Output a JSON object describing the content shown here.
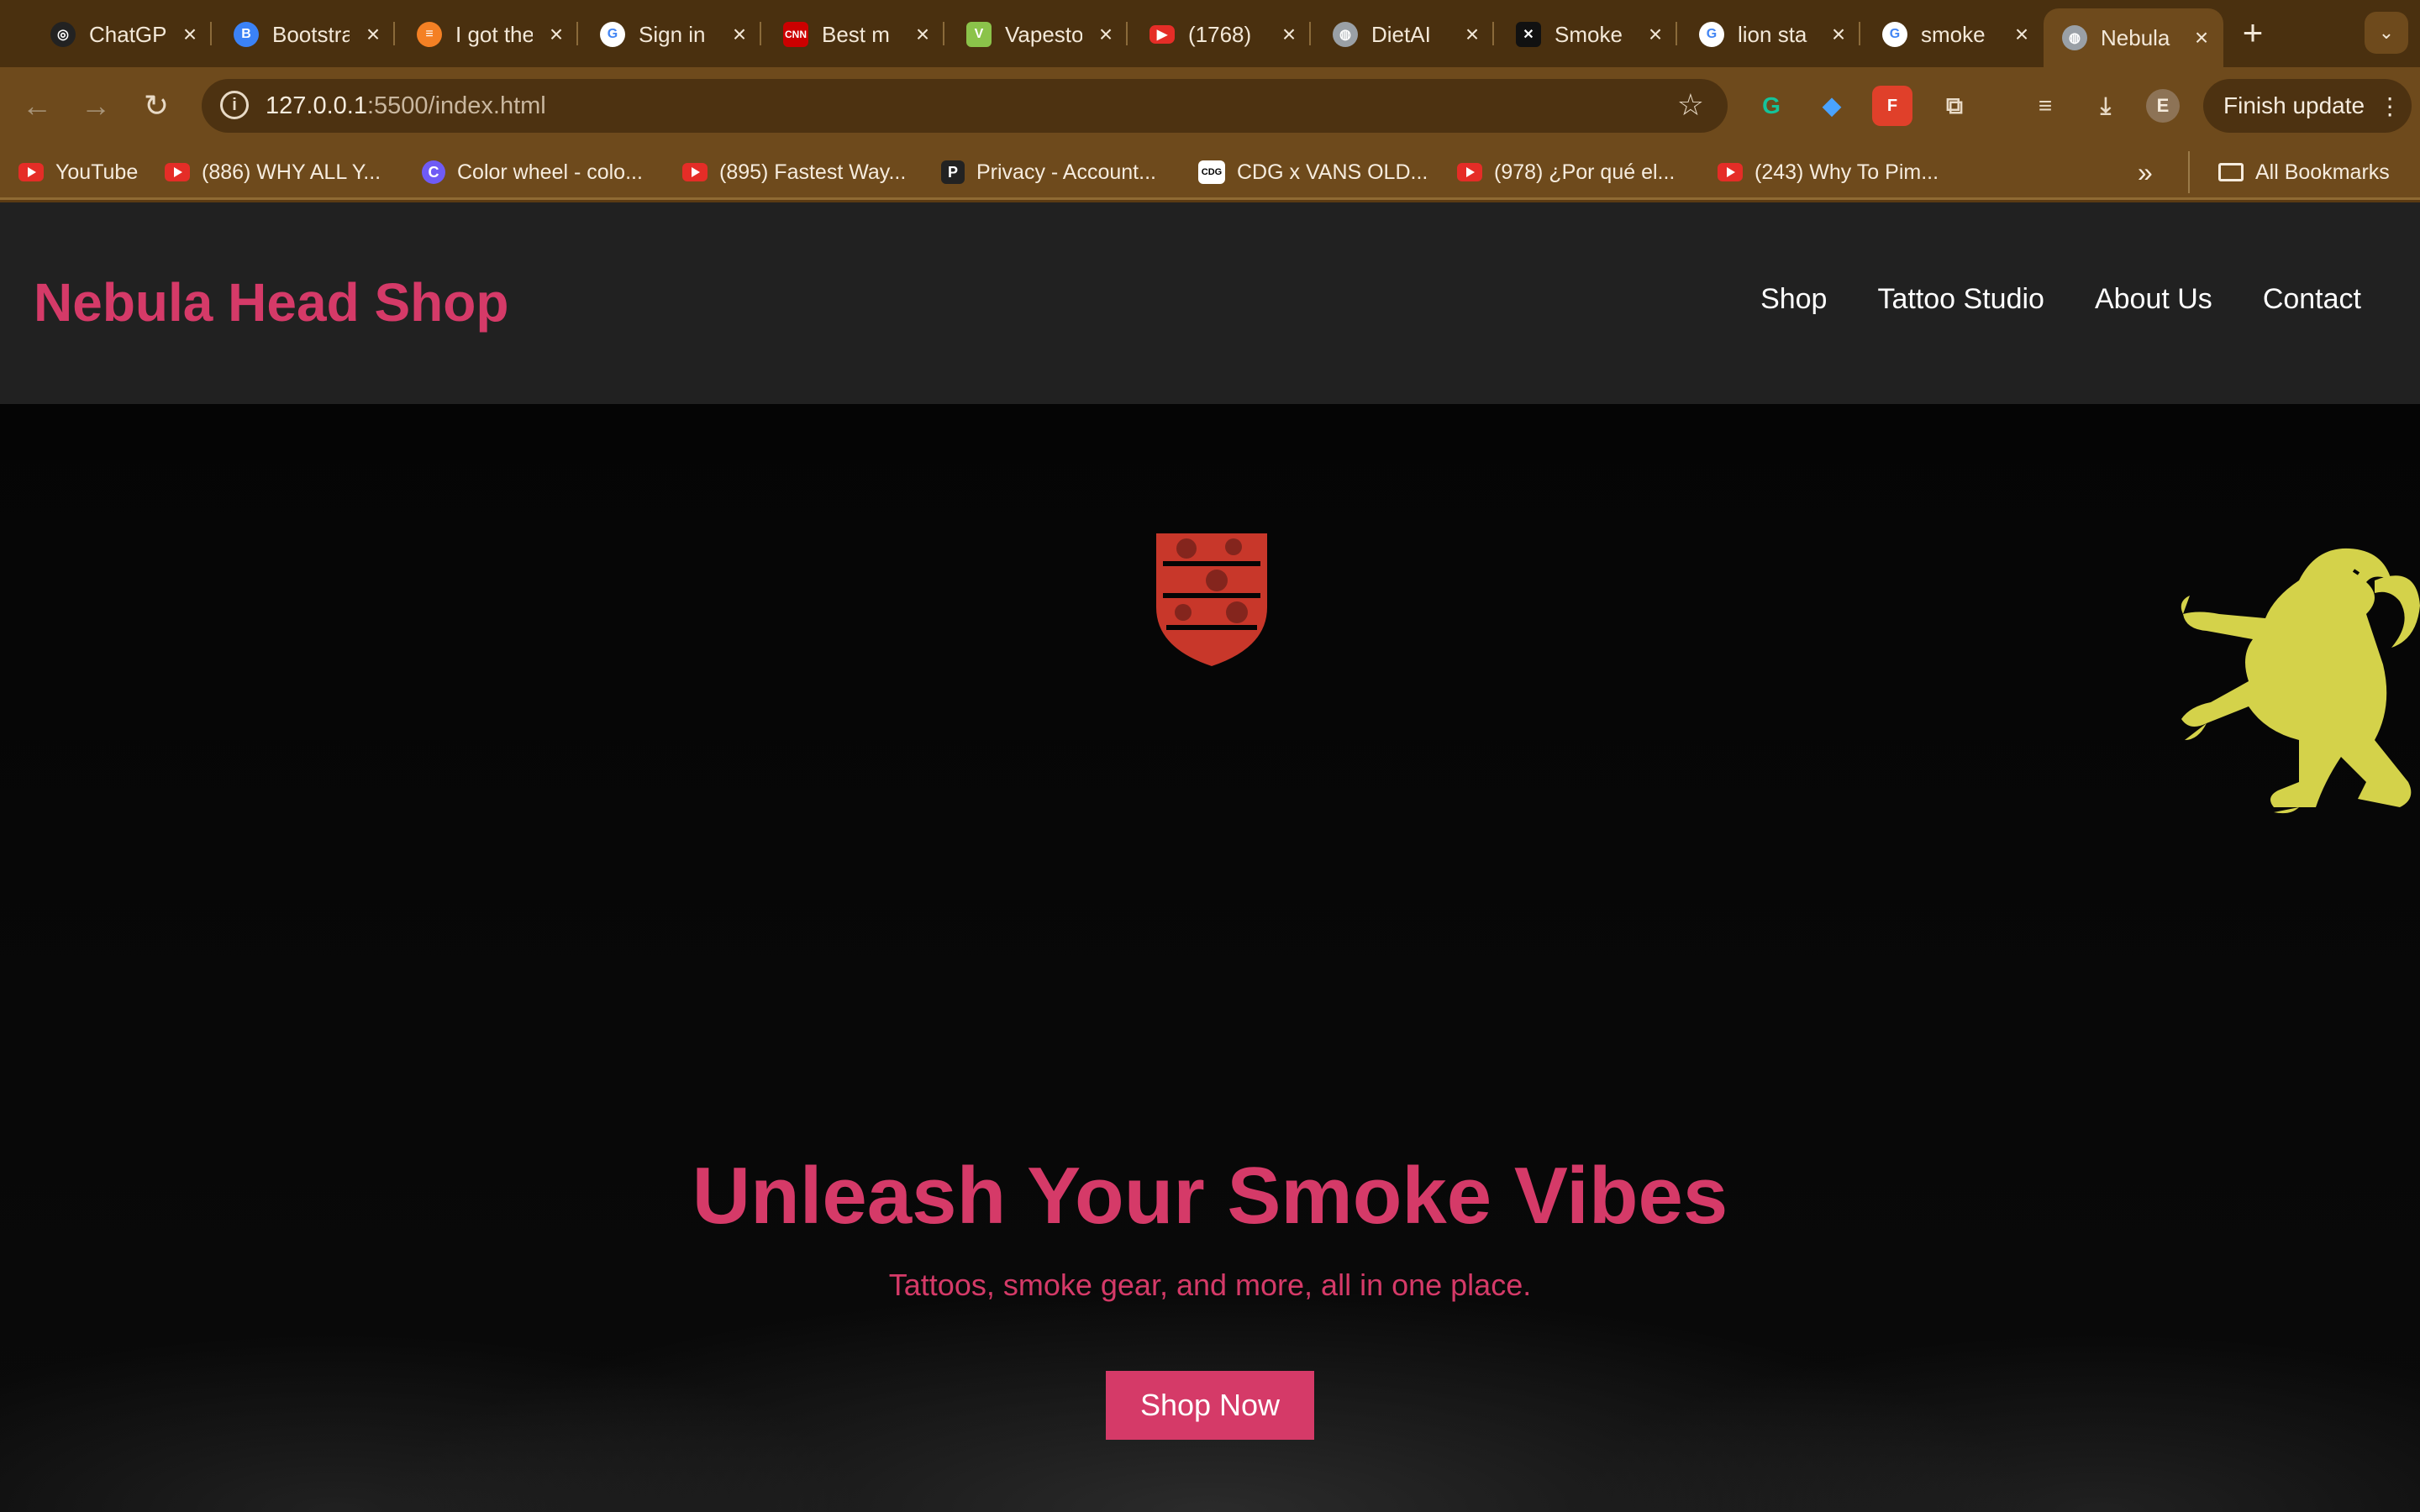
{
  "browser": {
    "tabs": [
      {
        "title": "ChatGPT",
        "icon": "chatgpt-icon",
        "color": "#ffffff"
      },
      {
        "title": "Bootstrap",
        "icon": "bootstrap-icon",
        "color": "#3b82f6"
      },
      {
        "title": "I got the",
        "icon": "stackoverflow-icon",
        "color": "#f48024"
      },
      {
        "title": "Sign in",
        "icon": "google-icon",
        "color": "#ffffff"
      },
      {
        "title": "Best m",
        "icon": "cnn-icon",
        "color": "#cc0000"
      },
      {
        "title": "Vapestore",
        "icon": "vapestore-icon",
        "color": "#8bc34a"
      },
      {
        "title": "(1768)",
        "icon": "youtube-icon",
        "color": "#e52d27"
      },
      {
        "title": "DietAI",
        "icon": "globe-icon",
        "color": "#9aa0a6"
      },
      {
        "title": "Smoke",
        "icon": "x-logo-icon",
        "color": "#111111"
      },
      {
        "title": "lion sta",
        "icon": "google-icon",
        "color": "#ffffff"
      },
      {
        "title": "smoke",
        "icon": "google-icon",
        "color": "#ffffff"
      },
      {
        "title": "Nebula",
        "icon": "globe-icon",
        "color": "#9aa0a6",
        "active": true
      }
    ],
    "url_host": "127.0.0.1",
    "url_path": ":5500/index.html",
    "finish_update_label": "Finish update",
    "profile_initial": "E",
    "bookmarks": [
      {
        "label": "YouTube",
        "icon": "youtube-icon"
      },
      {
        "label": "(886) WHY ALL Y...",
        "icon": "youtube-icon"
      },
      {
        "label": "Color wheel - colo...",
        "icon": "canva-icon"
      },
      {
        "label": "(895) Fastest Way...",
        "icon": "youtube-icon"
      },
      {
        "label": "Privacy - Account...",
        "icon": "p-icon"
      },
      {
        "label": "CDG x VANS OLD...",
        "icon": "cdg-icon"
      },
      {
        "label": "(978) ¿Por qué el...",
        "icon": "youtube-icon"
      },
      {
        "label": "(243) Why To Pim...",
        "icon": "youtube-icon"
      }
    ],
    "all_bookmarks_label": "All Bookmarks"
  },
  "site": {
    "brand": "Nebula Head Shop",
    "nav": [
      "Shop",
      "Tattoo Studio",
      "About Us",
      "Contact"
    ],
    "hero_title": "Unleash Your Smoke Vibes",
    "hero_subtitle": "Tattoos, smoke gear, and more, all in one place.",
    "cta_label": "Shop Now",
    "accent_color": "#d53a68",
    "crest_color": "#c8372a",
    "lion_color": "#d4d24a"
  }
}
